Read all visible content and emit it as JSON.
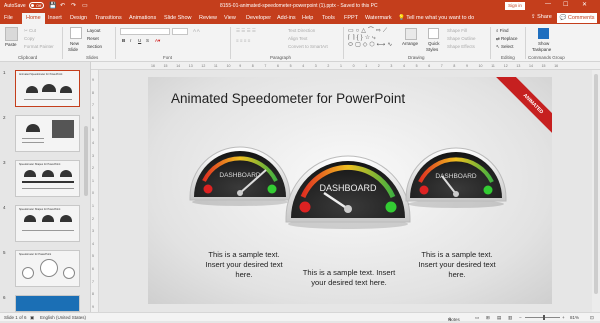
{
  "titlebar": {
    "autosave_label": "AutoSave",
    "autosave_state": "Off",
    "doc_title": "8155-01-animated-speedometer-powerpoint (1).pptx - Saved to this PC",
    "signin_label": "Sign in",
    "minimize": "—",
    "maximize": "☐",
    "close": "✕",
    "save_icon": "💾",
    "undo_icon": "↶",
    "redo_icon": "↷",
    "present_icon": "▭"
  },
  "tabs": [
    "File",
    "Home",
    "Insert",
    "Design",
    "Transitions",
    "Animations",
    "Slide Show",
    "Review",
    "View",
    "Developer",
    "Add-ins",
    "Help",
    "Tools",
    "FPPT",
    "Watermark"
  ],
  "tell_me": "Tell me what you want to do",
  "share_label": "Share",
  "comments_label": "Comments",
  "ribbon": {
    "clipboard": {
      "paste": "Paste",
      "cut": "Cut",
      "copy": "Copy",
      "format_painter": "Format Painter",
      "label": "Clipboard"
    },
    "slides": {
      "new_slide": "New",
      "new_slide2": "Slide",
      "layout": "Layout",
      "reset": "Reset",
      "section": "Section",
      "label": "Slides"
    },
    "font": {
      "bold": "B",
      "italic": "I",
      "underline": "U",
      "strike": "S",
      "label": "Font"
    },
    "paragraph": {
      "text_direction": "Text Direction",
      "align_text": "Align Text",
      "convert_smartart": "Convert to SmartArt",
      "label": "Paragraph"
    },
    "drawing": {
      "arrange": "Arrange",
      "quick_styles": "Quick",
      "quick_styles2": "Styles",
      "shape_fill": "Shape Fill",
      "shape_outline": "Shape Outline",
      "shape_effects": "Shape Effects",
      "label": "Drawing"
    },
    "editing": {
      "find": "Find",
      "replace": "Replace",
      "select": "Select",
      "label": "Editing"
    },
    "commands": {
      "show_taskpane": "Show",
      "show_taskpane2": "Taskpane",
      "label": "Commands Group"
    }
  },
  "thumbnails": [
    {
      "num": "1",
      "title": "Animated Speedometer for PowerPoint"
    },
    {
      "num": "2",
      "title": ""
    },
    {
      "num": "3",
      "title": "Speedometer Shapes for PowerPoint"
    },
    {
      "num": "4",
      "title": "Speedometer Shapes for PowerPoint"
    },
    {
      "num": "5",
      "title": "Speedometer for PowerPoint"
    },
    {
      "num": "6",
      "title": ""
    }
  ],
  "ruler_marks": [
    "16",
    "15",
    "14",
    "13",
    "12",
    "11",
    "10",
    "9",
    "8",
    "7",
    "6",
    "5",
    "4",
    "3",
    "2",
    "1",
    "0",
    "1",
    "2",
    "3",
    "4",
    "5",
    "6",
    "7",
    "8",
    "9",
    "10",
    "11",
    "12",
    "13",
    "14",
    "15",
    "16"
  ],
  "vruler_marks": [
    "9",
    "8",
    "7",
    "6",
    "5",
    "4",
    "3",
    "2",
    "1",
    "0",
    "1",
    "2",
    "3",
    "4",
    "5",
    "6",
    "7",
    "8",
    "9"
  ],
  "slide": {
    "title": "Animated Speedometer for PowerPoint",
    "banner": "ANIMATED",
    "gauge_left_label": "DASHBOARD",
    "gauge_center_label": "DASHBOARD",
    "gauge_right_label": "DASHBOARD",
    "text_left": [
      "This is a sample text.",
      "Insert your desired text",
      "here."
    ],
    "text_center": [
      "This is a sample text. Insert",
      "your desired text here."
    ],
    "text_right": [
      "This is a sample text.",
      "Insert your desired text",
      "here."
    ]
  },
  "status": {
    "slide_count": "Slide 1 of 6",
    "language": "English (United States)",
    "notes": "Notes",
    "zoom": "81%"
  }
}
